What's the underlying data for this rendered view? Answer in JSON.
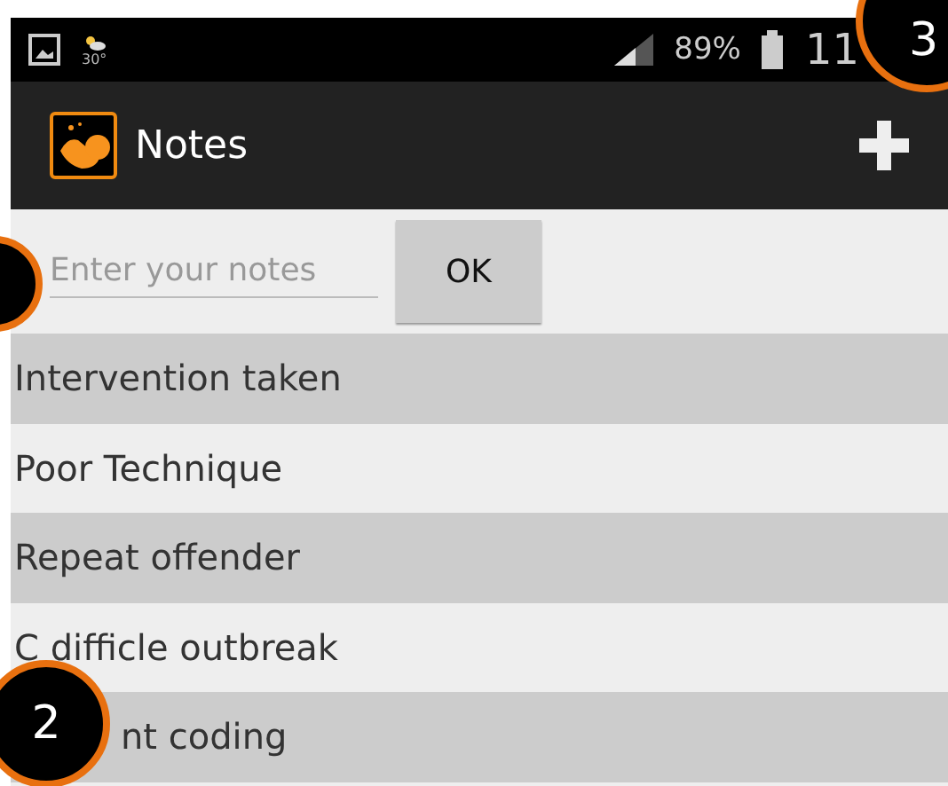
{
  "status_bar": {
    "weather": "30°",
    "battery": "89%",
    "time": "11"
  },
  "action_bar": {
    "title": "Notes"
  },
  "note_entry": {
    "placeholder": "Enter your notes",
    "button": "OK"
  },
  "notes": [
    {
      "text": "Intervention taken"
    },
    {
      "text": "Poor Technique"
    },
    {
      "text": "Repeat offender"
    },
    {
      "text": "C difficle outbreak"
    },
    {
      "text": "nt coding"
    }
  ],
  "callouts": [
    {
      "label": "3",
      "kind": "top-right"
    },
    {
      "label": "2",
      "kind": "bottom-left"
    },
    {
      "kind": "left"
    }
  ]
}
